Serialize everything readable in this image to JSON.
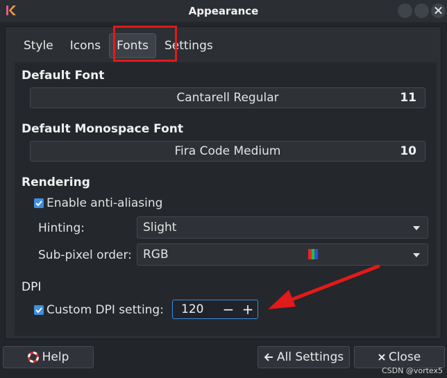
{
  "window": {
    "title": "Appearance"
  },
  "tabs": [
    {
      "label": "Style"
    },
    {
      "label": "Icons"
    },
    {
      "label": "Fonts"
    },
    {
      "label": "Settings"
    }
  ],
  "active_tab": "Fonts",
  "default_font": {
    "title": "Default Font",
    "name": "Cantarell Regular",
    "size": "11"
  },
  "monospace_font": {
    "title": "Default Monospace Font",
    "name": "Fira Code Medium",
    "size": "10"
  },
  "rendering": {
    "title": "Rendering",
    "antialias_label": "Enable anti-aliasing",
    "antialias_checked": true,
    "hinting_label": "Hinting:",
    "hinting_value": "Slight",
    "subpixel_label": "Sub-pixel order:",
    "subpixel_value": "RGB"
  },
  "dpi": {
    "title": "DPI",
    "custom_label": "Custom DPI setting:",
    "custom_checked": true,
    "value": "120",
    "minus": "−",
    "plus": "+"
  },
  "buttons": {
    "help": "Help",
    "all_settings": "All Settings",
    "close": "Close"
  },
  "watermark": "CSDN @vortex5",
  "colors": {
    "accent": "#3d8fe0",
    "annotation_red": "#e11a1a"
  }
}
